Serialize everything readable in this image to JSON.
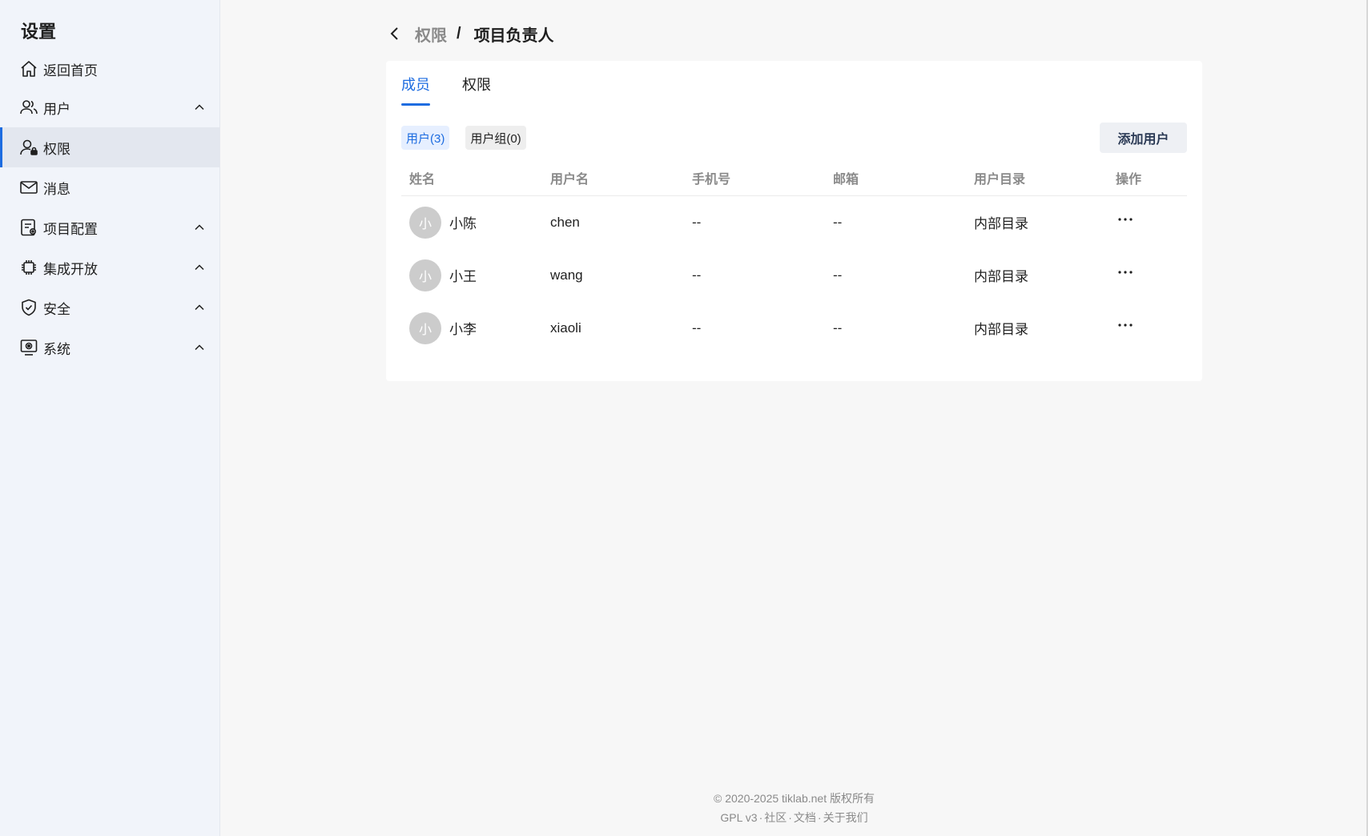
{
  "sidebar": {
    "title": "设置",
    "items": [
      {
        "label": "返回首页",
        "icon": "home-icon"
      },
      {
        "label": "用户",
        "icon": "users-icon",
        "expandable": true
      },
      {
        "label": "权限",
        "icon": "user-lock-icon",
        "active": true
      },
      {
        "label": "消息",
        "icon": "mail-icon"
      },
      {
        "label": "项目配置",
        "icon": "project-config-icon",
        "expandable": true
      },
      {
        "label": "集成开放",
        "icon": "chip-icon",
        "expandable": true
      },
      {
        "label": "安全",
        "icon": "shield-icon",
        "expandable": true
      },
      {
        "label": "系统",
        "icon": "system-monitor-icon",
        "expandable": true
      }
    ]
  },
  "breadcrumb": {
    "parent": "权限",
    "separator": "/",
    "current": "项目负责人"
  },
  "tabs": [
    {
      "label": "成员",
      "active": true
    },
    {
      "label": "权限",
      "active": false
    }
  ],
  "filters": [
    {
      "label": "用户(3)",
      "active": true
    },
    {
      "label": "用户组(0)",
      "active": false
    }
  ],
  "add_user_label": "添加用户",
  "table": {
    "columns": [
      "姓名",
      "用户名",
      "手机号",
      "邮箱",
      "用户目录",
      "操作"
    ],
    "rows": [
      {
        "avatar": "小",
        "name": "小陈",
        "username": "chen",
        "phone": "--",
        "email": "--",
        "directory": "内部目录"
      },
      {
        "avatar": "小",
        "name": "小王",
        "username": "wang",
        "phone": "--",
        "email": "--",
        "directory": "内部目录"
      },
      {
        "avatar": "小",
        "name": "小李",
        "username": "xiaoli",
        "phone": "--",
        "email": "--",
        "directory": "内部目录"
      }
    ]
  },
  "footer": {
    "copyright": "© 2020-2025 tiklab.net 版权所有",
    "links": [
      "GPL v3",
      "社区",
      "文档",
      "关于我们"
    ],
    "separator": "·"
  },
  "colors": {
    "accent": "#1d6ce0",
    "sidebar_bg": "#f1f4fa",
    "page_bg": "#f7f7f7",
    "muted_text": "#8a8a8a",
    "avatar_bg": "#cccccc"
  }
}
